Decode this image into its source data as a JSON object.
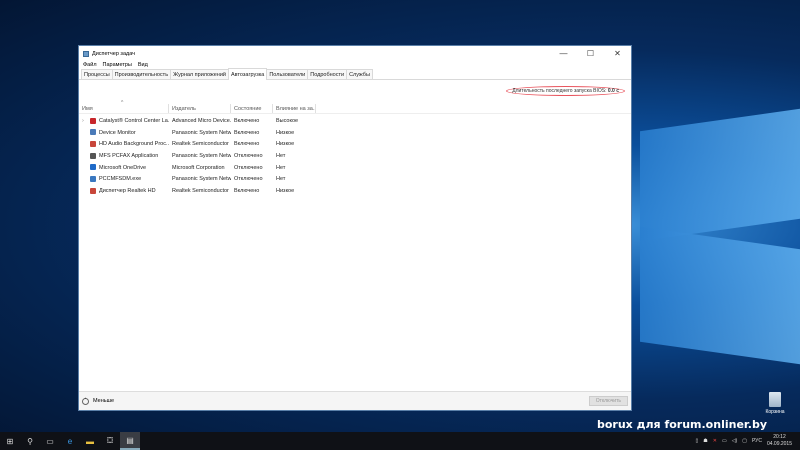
{
  "window": {
    "title": "Диспетчер задач",
    "controls": [
      "—",
      "☐",
      "✕"
    ]
  },
  "menu": [
    "Файл",
    "Параметры",
    "Вид"
  ],
  "tabs": [
    "Процессы",
    "Производительность",
    "Журнал приложений",
    "Автозагрузка",
    "Пользователи",
    "Подробности",
    "Службы"
  ],
  "active_tab": 3,
  "bios": {
    "label": "Длительность последнего запуска BIOS:",
    "value": "0.0 с"
  },
  "columns": [
    "Имя",
    "Издатель",
    "Состояние",
    "Влияние на за..."
  ],
  "rows": [
    {
      "name": "Catalyst® Control Center La...",
      "publisher": "Advanced Micro Device...",
      "state": "Включено",
      "impact": "Высокое",
      "color": "#c8262b",
      "expand": "›"
    },
    {
      "name": "Device Monitor",
      "publisher": "Panasonic System Netw...",
      "state": "Включено",
      "impact": "Низкое",
      "color": "#4a7ab8",
      "expand": ""
    },
    {
      "name": "HD Audio Background Proc...",
      "publisher": "Realtek Semiconductor",
      "state": "Включено",
      "impact": "Низкое",
      "color": "#c8463a",
      "expand": ""
    },
    {
      "name": "MFS PCFAX Application",
      "publisher": "Panasonic System Netw...",
      "state": "Отключено",
      "impact": "Нет",
      "color": "#555",
      "expand": ""
    },
    {
      "name": "Microsoft OneDrive",
      "publisher": "Microsoft Corporation",
      "state": "Отключено",
      "impact": "Нет",
      "color": "#1e6ac8",
      "expand": ""
    },
    {
      "name": "PCCMFSDM.exe",
      "publisher": "Panasonic System Netw...",
      "state": "Отключено",
      "impact": "Нет",
      "color": "#3a78c0",
      "expand": ""
    },
    {
      "name": "Диспетчер Realtek HD",
      "publisher": "Realtek Semiconductor",
      "state": "Включено",
      "impact": "Низкое",
      "color": "#c8463a",
      "expand": ""
    }
  ],
  "footer": {
    "less": "Меньше",
    "disable": "Отключить"
  },
  "desktop": {
    "recycle_bin": "Корзина",
    "watermark": "borux для forum.onliner.by"
  },
  "taskbar": {
    "lang": "РУС",
    "time": "20:12",
    "date": "04.09.2015"
  }
}
